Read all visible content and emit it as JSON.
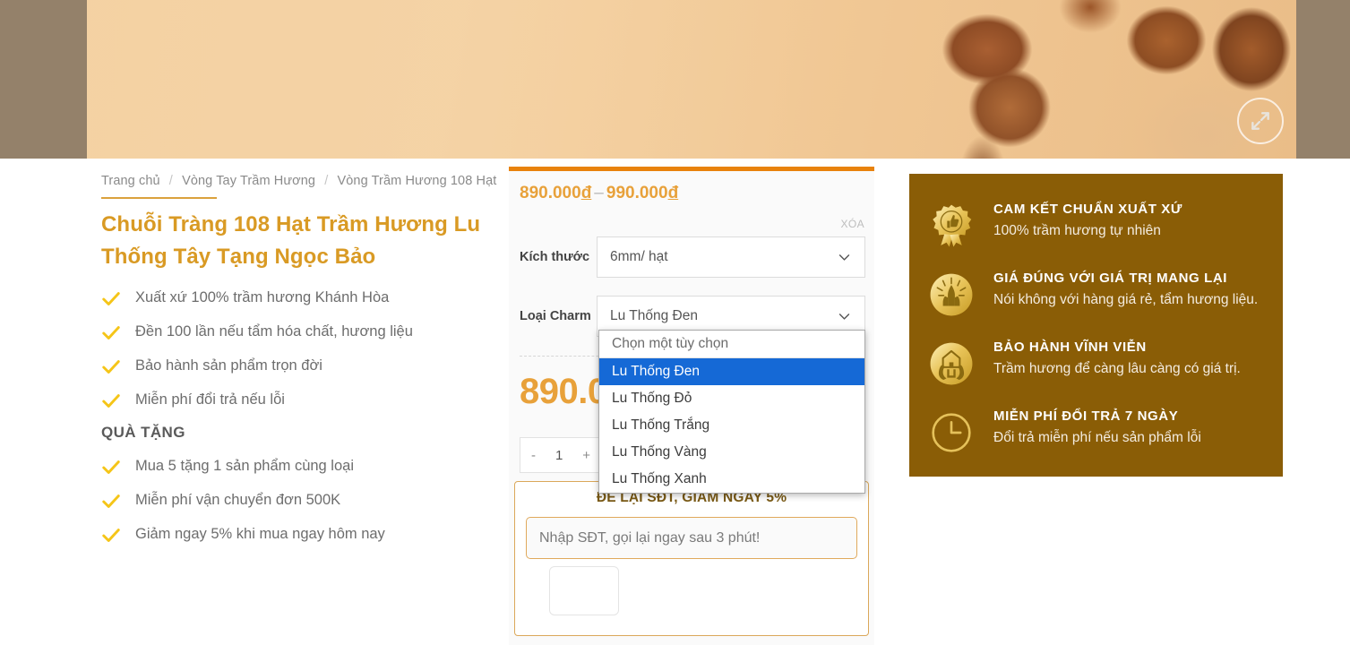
{
  "banner": {
    "alt": "tram-huong-beads-photo",
    "zoom_icon": "expand-arrows-icon"
  },
  "breadcrumb": {
    "items": [
      "Trang chủ",
      "Vòng Tay Trầm Hương",
      "Vòng Trầm Hương 108 Hạt"
    ],
    "separator": "/"
  },
  "product": {
    "title": "Chuỗi Tràng 108 Hạt Trầm Hương Lu Thống Tây Tạng Ngọc Bảo",
    "features": [
      "Xuất xứ 100% trầm hương Khánh Hòa",
      "Đền 100 lần nếu tẩm hóa chất, hương liệu",
      "Bảo hành sản phẩm trọn đời",
      "Miễn phí đổi trả nếu lỗi"
    ],
    "gift_heading": "QUÀ TẶNG",
    "gifts": [
      "Mua 5 tặng 1 sản phẩm cùng loại",
      "Miễn phí vận chuyển đơn 500K",
      "Giảm ngay 5% khi mua ngay hôm nay"
    ]
  },
  "purchase": {
    "price_min": "890.000",
    "price_max": "990.000",
    "currency": "đ",
    "price_dash": "–",
    "clear_label": "XÓA",
    "selected_price": "890.000",
    "variations": [
      {
        "label": "Kích thước",
        "value": "6mm/ hạt",
        "name": "size"
      },
      {
        "label": "Loại Charm",
        "value": "Lu Thống Đen",
        "name": "charm"
      }
    ],
    "quantity": {
      "minus": "-",
      "value": "1",
      "plus": "+"
    }
  },
  "dropdown": {
    "open_for": "Loại Charm",
    "options": [
      "Chọn một tùy chọn",
      "Lu Thống Đen",
      "Lu Thống Đỏ",
      "Lu Thống Trắng",
      "Lu Thống Vàng",
      "Lu Thống Xanh"
    ],
    "selected_index": 1,
    "highlight_color": "#1569d6"
  },
  "lead_form": {
    "title": "ĐỂ LẠI SĐT, GIẢM NGAY 5%",
    "placeholder": "Nhập SĐT, gọi lại ngay sau 3 phút!",
    "value": "",
    "submit_label": ""
  },
  "trust": {
    "background": "#8a5d06",
    "items": [
      {
        "icon": "medal-thumbs-up-icon",
        "title": "CAM KẾT CHUẨN XUẤT XỨ",
        "desc": "100% trầm hương tự nhiên"
      },
      {
        "icon": "praying-hands-icon",
        "title": "GIÁ ĐÚNG VỚI GIÁ TRỊ MANG LẠI",
        "desc": "Nói không với hàng giá rẻ, tẩm hương liệu."
      },
      {
        "icon": "hands-holding-house-icon",
        "title": "BẢO HÀNH VĨNH VIỄN",
        "desc": "Trầm hương để càng lâu càng có giá trị."
      },
      {
        "icon": "clock-icon",
        "title": "MIỄN PHÍ ĐỔI TRẢ 7 NGÀY",
        "desc": "Đổi trả miễn phí nếu sản phẩm lỗi"
      }
    ]
  },
  "colors": {
    "accent_orange": "#e8820c",
    "price_gold": "#e8a13a",
    "title_gold": "#d99a24",
    "panel_brown": "#8a5d06",
    "check_yellow": "#f5c518"
  }
}
